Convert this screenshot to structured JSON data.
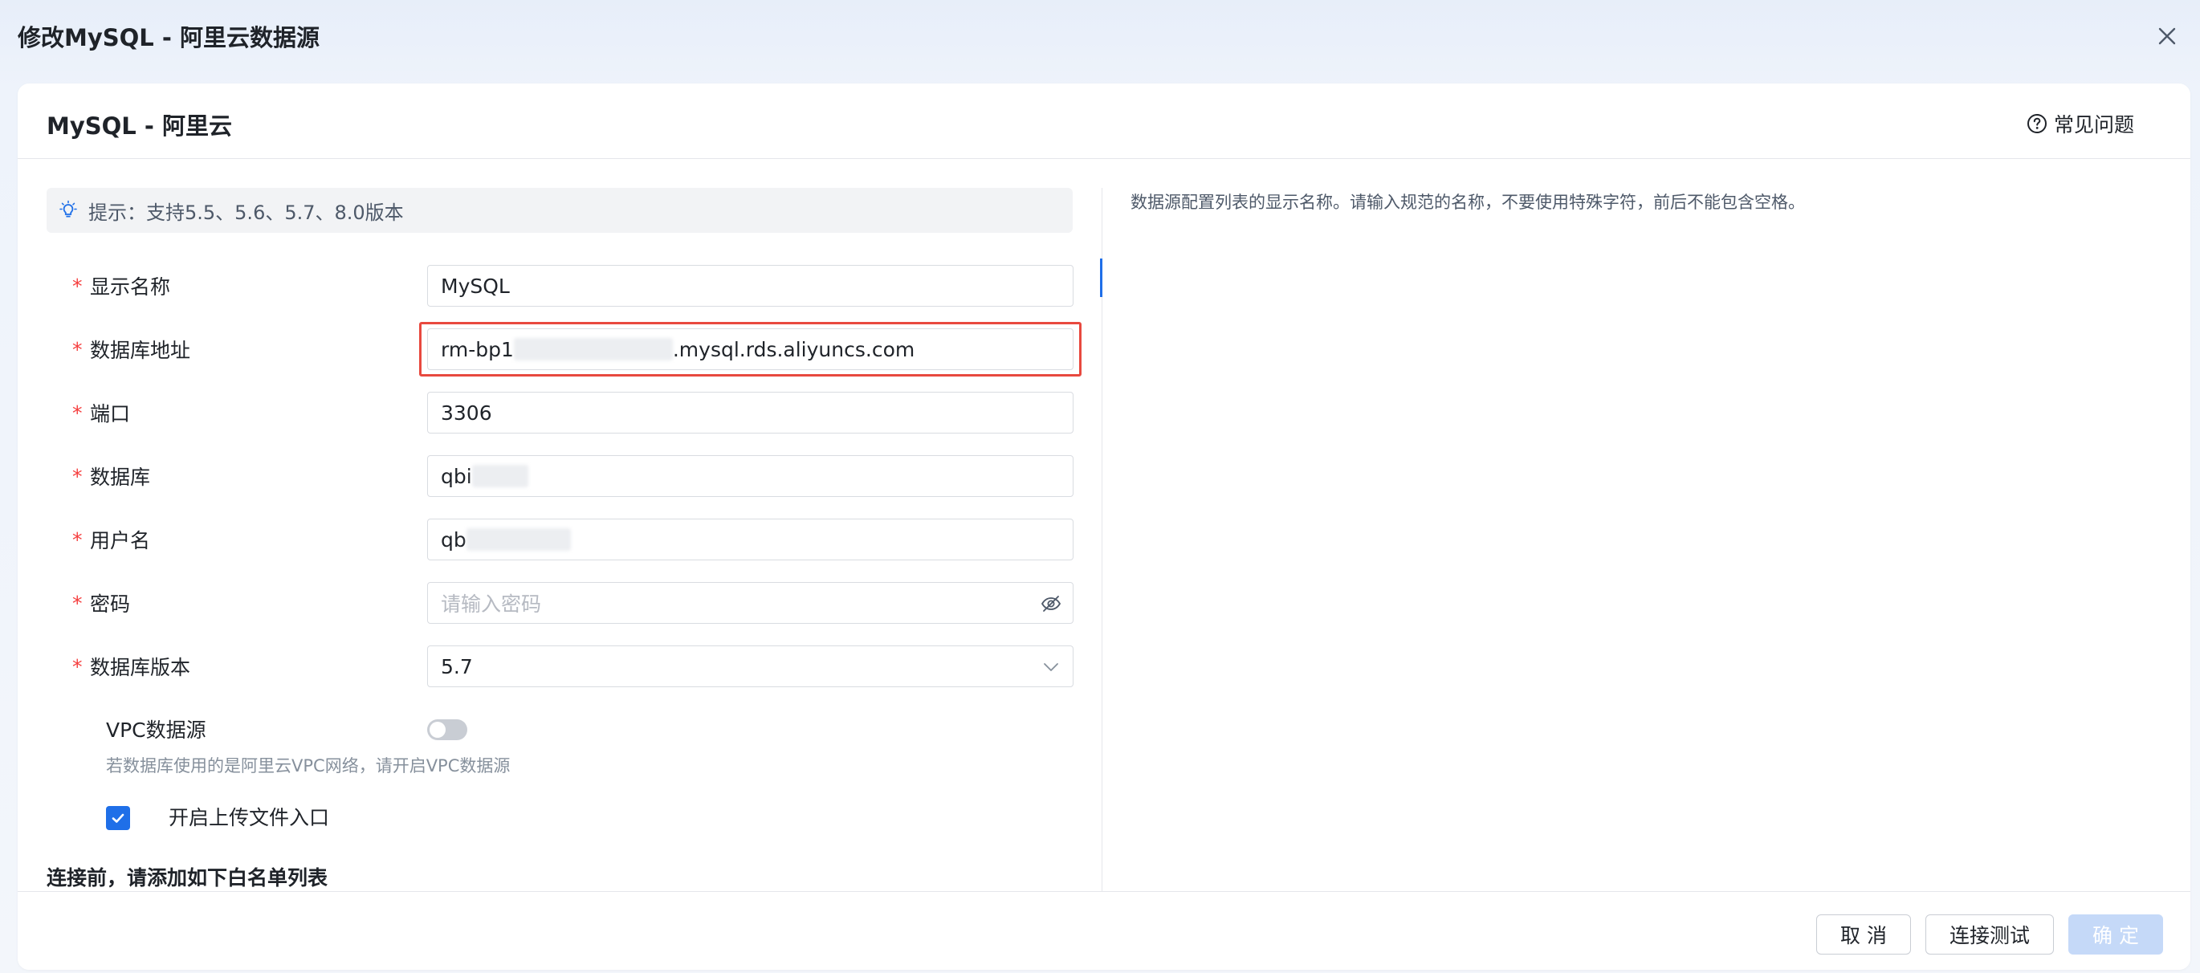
{
  "modal": {
    "title": "修改MySQL - 阿里云数据源",
    "close_icon": "close-icon"
  },
  "card": {
    "title": "MySQL - 阿里云",
    "faq_label": "常见问题",
    "faq_icon": "question-circle-icon"
  },
  "tip": {
    "icon": "lightbulb-icon",
    "text": "提示：支持5.5、5.6、5.7、8.0版本"
  },
  "form": {
    "display_name": {
      "label": "显示名称",
      "required": "*",
      "value": "MySQL"
    },
    "db_address": {
      "label": "数据库地址",
      "required": "*",
      "value_prefix": "rm-bp1",
      "value_suffix": ".mysql.rds.aliyuncs.com"
    },
    "port": {
      "label": "端口",
      "required": "*",
      "value": "3306"
    },
    "database": {
      "label": "数据库",
      "required": "*",
      "value": "qbi"
    },
    "username": {
      "label": "用户名",
      "required": "*",
      "value": "qb"
    },
    "password": {
      "label": "密码",
      "required": "*",
      "placeholder": "请输入密码",
      "icon": "eye-off-icon"
    },
    "db_version": {
      "label": "数据库版本",
      "required": "*",
      "value": "5.7",
      "icon": "chevron-down-icon"
    },
    "vpc": {
      "label": "VPC数据源",
      "enabled": false,
      "help": "若数据库使用的是阿里云VPC网络，请开启VPC数据源"
    },
    "upload": {
      "label": "开启上传文件入口",
      "checked": true
    }
  },
  "whitelist_title": "连接前，请添加如下白名单列表",
  "help_panel": {
    "text": "数据源配置列表的显示名称。请输入规范的名称，不要使用特殊字符，前后不能包含空格。"
  },
  "footer": {
    "cancel_label": "取 消",
    "test_label": "连接测试",
    "ok_label": "确 定"
  },
  "colors": {
    "primary": "#1f6fe8",
    "required": "#f53f3f",
    "highlight": "#e8493f",
    "ok_disabled": "#c5d9f8"
  }
}
